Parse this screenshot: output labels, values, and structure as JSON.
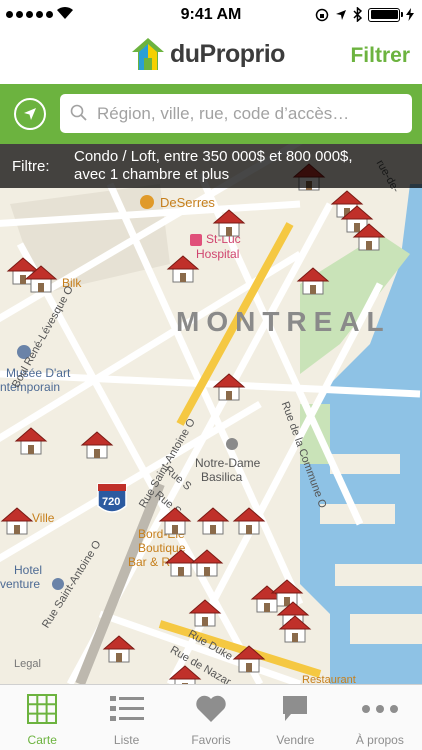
{
  "status_bar": {
    "time": "9:41 AM"
  },
  "header": {
    "logo_text": "duProprio",
    "filter_button": "Filtrer"
  },
  "search": {
    "placeholder": "Région, ville, rue, code d’accès…"
  },
  "filter_banner": {
    "label": "Filtre:",
    "line1": "Condo / Loft, entre 350 000$ et 800 000$,",
    "line2": "avec 1 chambre et plus"
  },
  "map": {
    "city_label": "MONTREAL",
    "pois": {
      "deserres": "DeSerres",
      "hospital_1": "St-Luc",
      "hospital_2": "Hospital",
      "bilk": "Bilk",
      "musee_1": "Musée D'art",
      "musee_2": "ntemporain",
      "notre_dame_1": "Notre-Dame",
      "notre_dame_2": "Basilica",
      "bord_1": "Bord-Ele",
      "bord_2": "Boutique",
      "bord_3": "Bar & R",
      "ville": "e Ville",
      "hotel_1": "Hotel",
      "hotel_2": "venture",
      "restaurant": "Restaurant",
      "legal": "Legal",
      "highway": "720"
    },
    "streets": {
      "rene_levesque": "Boul René-Lévesque O",
      "saint_antoine_1": "Rue Saint-Antoine O",
      "saint_antoine_2": "Rue Saint-Antoine O",
      "commune": "Rue de la Commune O",
      "duke": "Rue Duke",
      "nazareth": "Rue de Nazar",
      "saint_1": "Rue S",
      "saint_2": "Rue S",
      "rue_de": "rue-de-"
    }
  },
  "tabs": [
    {
      "label": "Carte",
      "icon": "grid-icon",
      "active": true
    },
    {
      "label": "Liste",
      "icon": "list-icon",
      "active": false
    },
    {
      "label": "Favoris",
      "icon": "heart-icon",
      "active": false
    },
    {
      "label": "Vendre",
      "icon": "speech-bubble-icon",
      "active": false
    },
    {
      "label": "À propos",
      "icon": "more-dots-icon",
      "active": false
    }
  ],
  "colors": {
    "brand_green": "#6cb33f",
    "map_land": "#f2eee2",
    "map_water": "#8ec2e5",
    "house_roof": "#c0302a"
  }
}
